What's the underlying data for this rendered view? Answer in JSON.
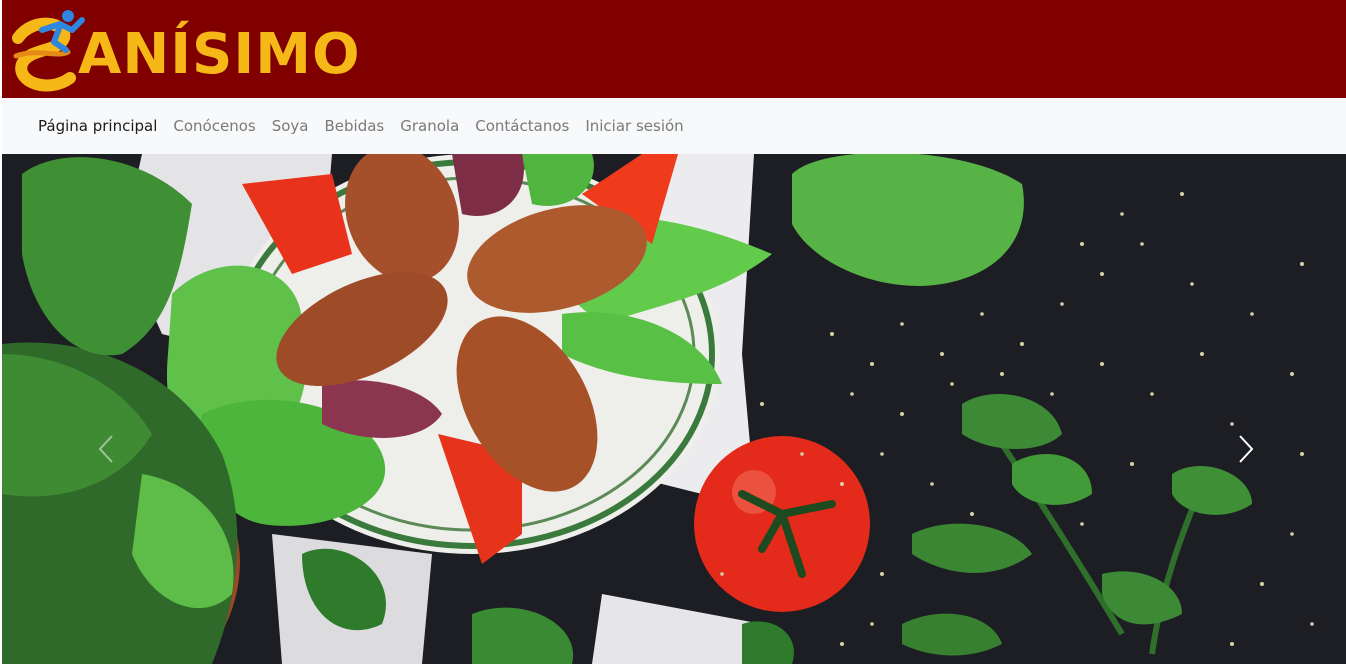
{
  "brand": {
    "name": "ANÍSIMO",
    "logo_icon": "runner-s-logo-icon",
    "header_color": "#800000",
    "logo_text_color": "#f6b817"
  },
  "nav": {
    "items": [
      {
        "label": "Página principal",
        "active": true
      },
      {
        "label": "Conócenos",
        "active": false
      },
      {
        "label": "Soya",
        "active": false
      },
      {
        "label": "Bebidas",
        "active": false
      },
      {
        "label": "Granola",
        "active": false
      },
      {
        "label": "Contáctanos",
        "active": false
      },
      {
        "label": "Iniciar sesión",
        "active": false
      }
    ]
  },
  "carousel": {
    "image": "kibbeh-salad-platter-photo",
    "prev_icon": "chevron-left-icon",
    "next_icon": "chevron-right-icon"
  }
}
